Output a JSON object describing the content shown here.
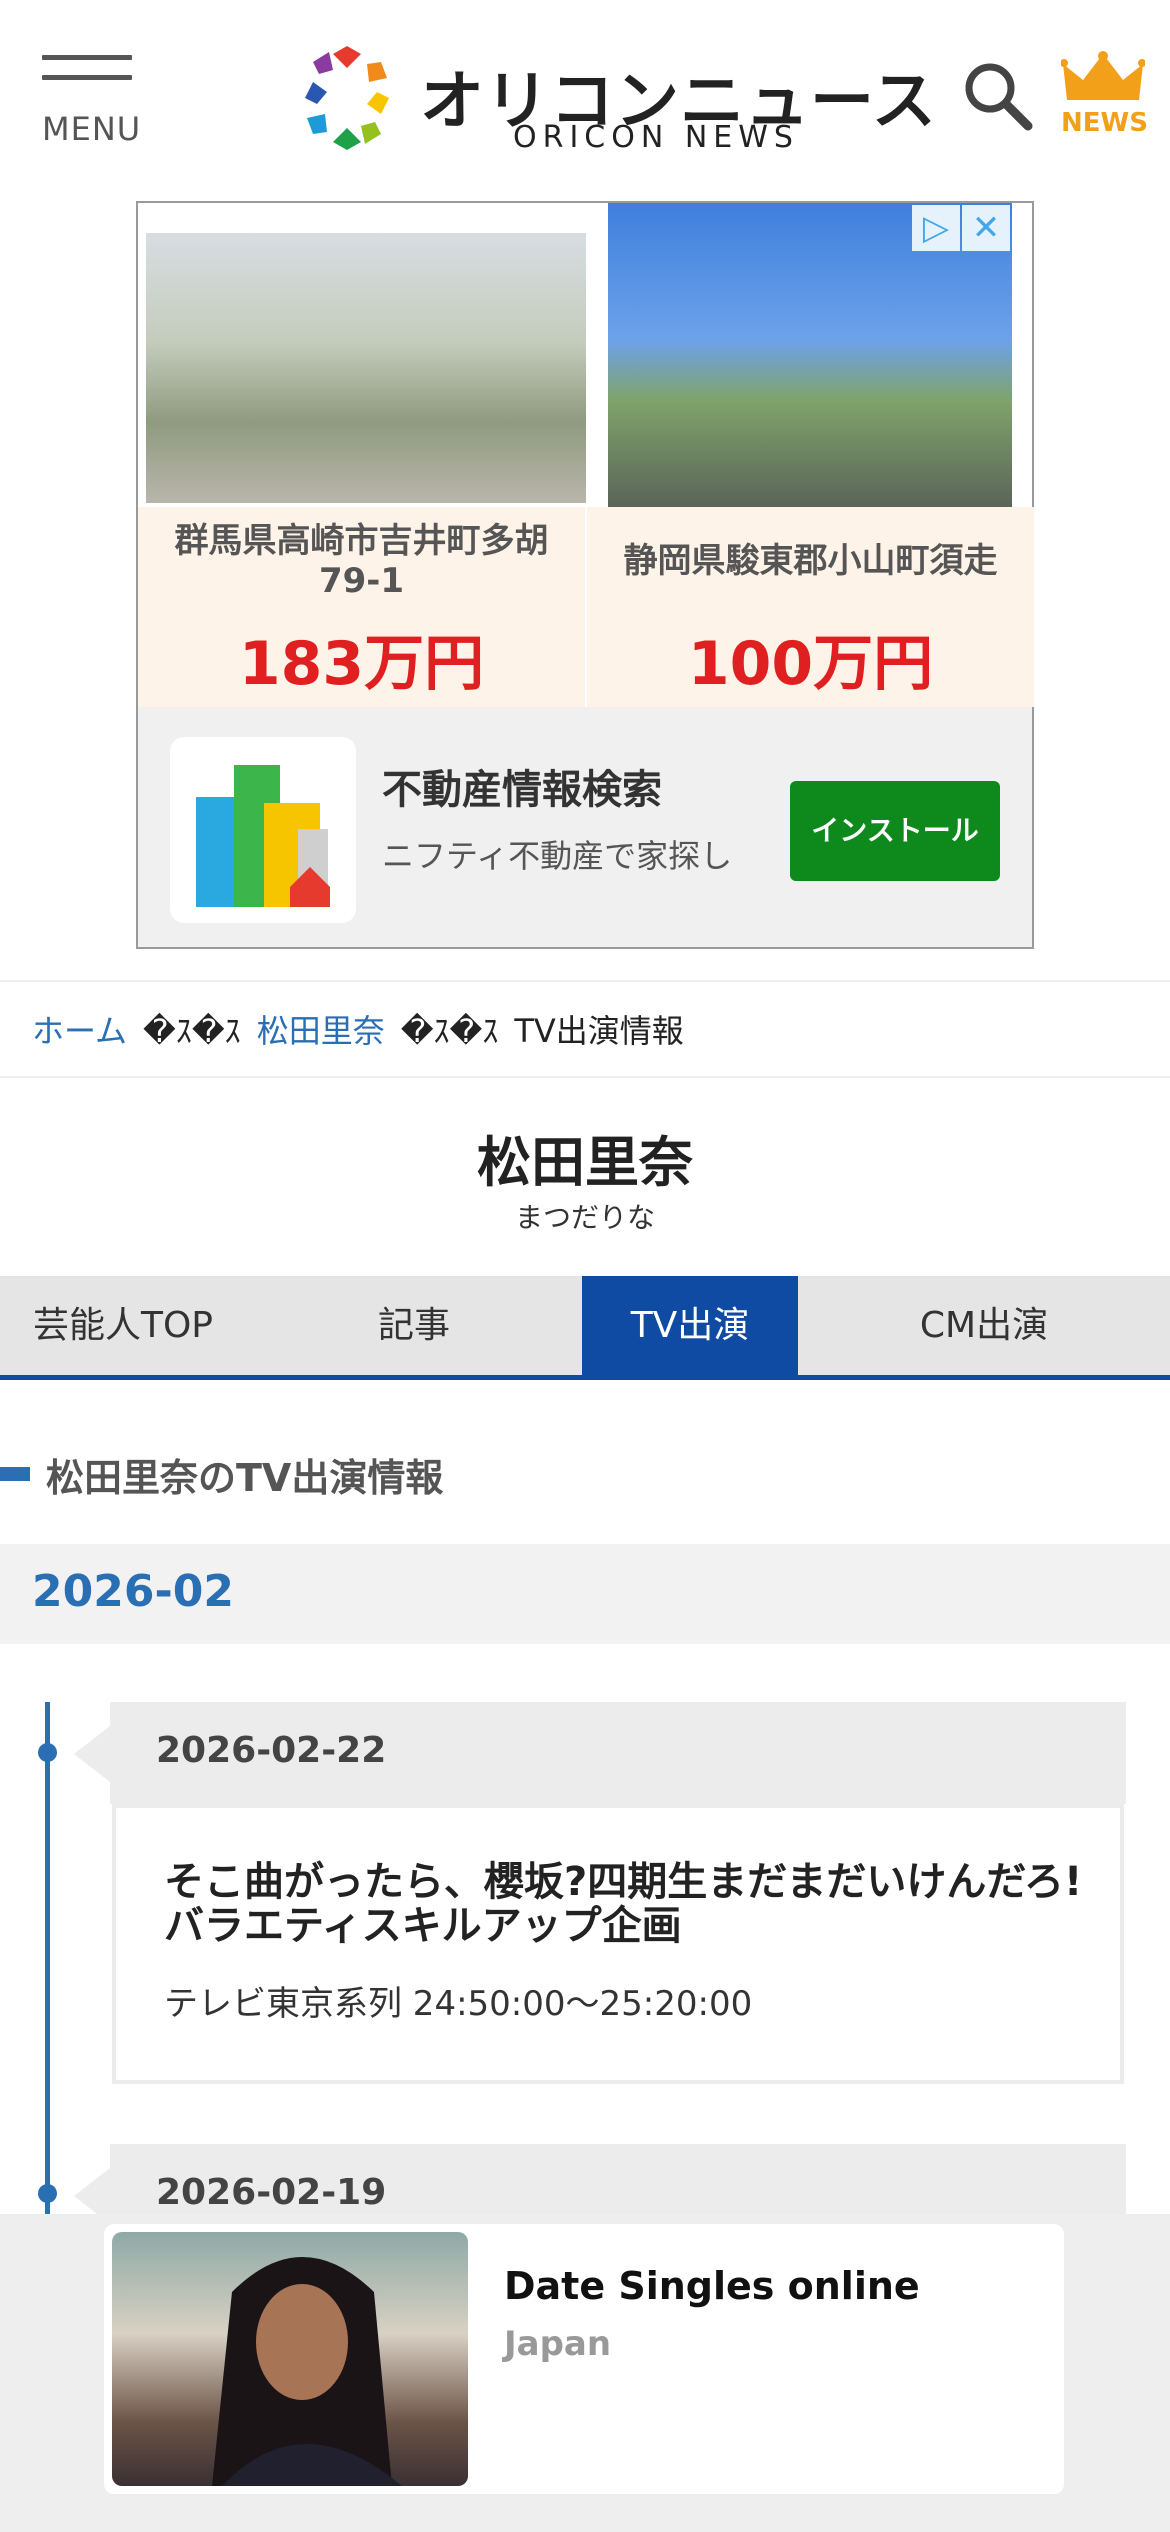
{
  "header": {
    "menu_label": "MENU",
    "logo_jp": "オリコンニュース",
    "logo_en": "ORICON NEWS",
    "news_label": "NEWS",
    "accent_color": "#f2a019"
  },
  "ad_top": {
    "listings": [
      {
        "location": "群馬県高崎市吉井町多胡",
        "location2": "79-1",
        "price": "183万円"
      },
      {
        "location": "静岡県駿東郡小山町須走",
        "location2": "",
        "price": "100万円"
      }
    ],
    "app_title": "不動産情報検索",
    "app_desc": "ニフティ不動産で家探し",
    "install_label": "インストール"
  },
  "breadcrumb": {
    "home": "ホーム",
    "separator": "�ｽ�ｽ",
    "person": "松田里奈",
    "current": "TV出演情報"
  },
  "profile": {
    "name": "松田里奈",
    "kana": "まつだりな"
  },
  "tabs": [
    {
      "label": "芸能人TOP",
      "active": false
    },
    {
      "label": "記事",
      "active": false
    },
    {
      "label": "TV出演",
      "active": true
    },
    {
      "label": "CM出演",
      "active": false
    }
  ],
  "section": {
    "title": "松田里奈のTV出演情報"
  },
  "month": "2026-02",
  "entries": [
    {
      "date": "2026-02-22",
      "title": "そこ曲がったら、櫻坂?四期生まだまだいけんだろ!バラエティスキルアップ企画",
      "channel": "テレビ東京系列 24:50:00～25:20:00"
    },
    {
      "date": "2026-02-19"
    }
  ],
  "ad_bottom": {
    "title": "Date Singles online",
    "subtitle": "Japan"
  },
  "colors": {
    "primary_blue": "#0f4ba3",
    "link_blue": "#2a6eb4",
    "price_red": "#e02020",
    "install_green": "#0e8a1c"
  }
}
